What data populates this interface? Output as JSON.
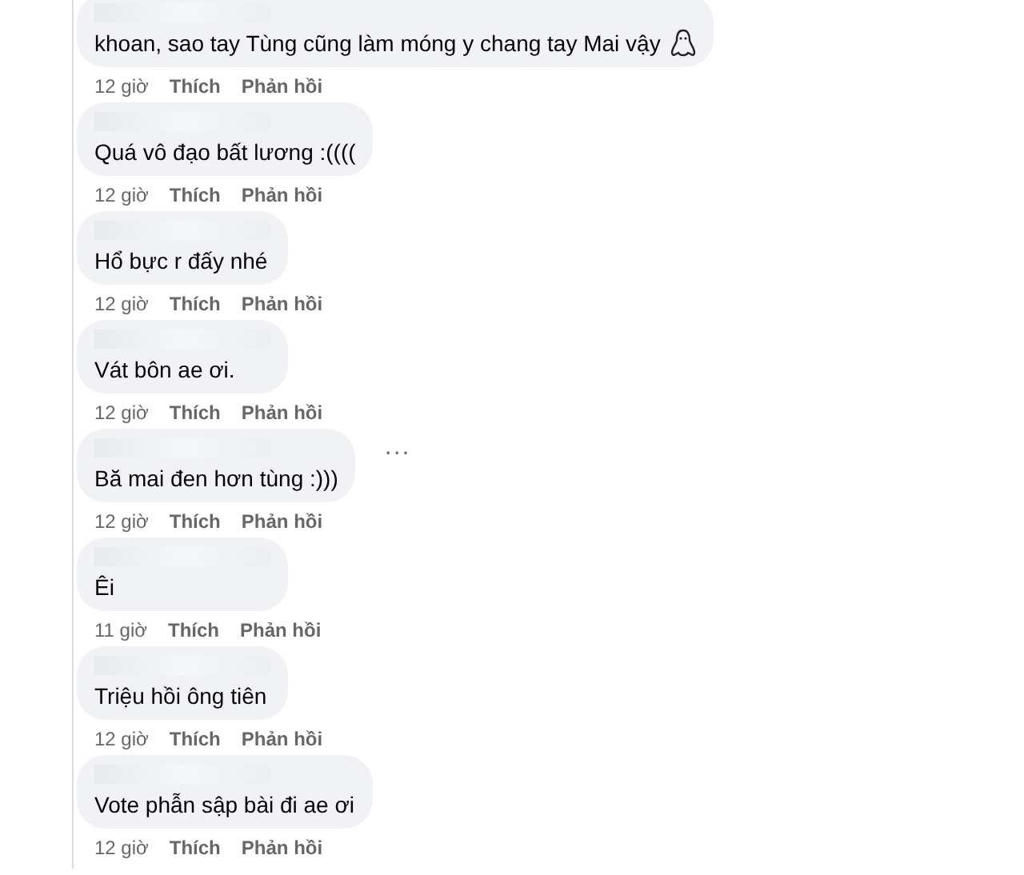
{
  "comments": [
    {
      "text": "khoan, sao tay Tùng cũng làm móng y chang tay Mai vậy",
      "emoji": true,
      "time": "12 giờ",
      "like": "Thích",
      "reply": "Phản hồi"
    },
    {
      "text": "Quá vô đạo bất lương :((((",
      "time": "12 giờ",
      "like": "Thích",
      "reply": "Phản hồi"
    },
    {
      "text": "Hổ bực r đấy nhé",
      "time": "12 giờ",
      "like": "Thích",
      "reply": "Phản hồi"
    },
    {
      "text": "Vát bôn ae ơi.",
      "time": "12 giờ",
      "like": "Thích",
      "reply": "Phản hồi"
    },
    {
      "text": "Bă mai đen hơn tùng :)))",
      "more": "···",
      "time": "12 giờ",
      "like": "Thích",
      "reply": "Phản hồi"
    },
    {
      "text": "Êi",
      "time": "11 giờ",
      "like": "Thích",
      "reply": "Phản hồi"
    },
    {
      "text": "Triệu hồi ông tiên",
      "time": "12 giờ",
      "like": "Thích",
      "reply": "Phản hồi"
    },
    {
      "text": "Vote phẫn sập bài đi ae ơi",
      "time": "12 giờ",
      "like": "Thích",
      "reply": "Phản hồi"
    }
  ]
}
